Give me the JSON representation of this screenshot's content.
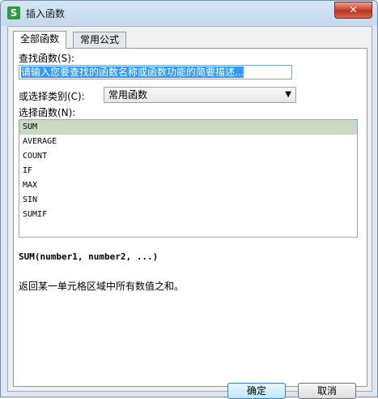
{
  "window": {
    "title": "插入函数",
    "app_icon": "S",
    "close_glyph": "✕"
  },
  "tabs": [
    {
      "label": "全部函数"
    },
    {
      "label": "常用公式"
    }
  ],
  "search": {
    "label": "查找函数(S):",
    "value": "请输入您要查找的函数名称或函数功能的简要描述..."
  },
  "category": {
    "label": "或选择类别(C):",
    "selected": "常用函数",
    "arrow": "▼"
  },
  "functions": {
    "label": "选择函数(N):",
    "items": [
      "SUM",
      "AVERAGE",
      "COUNT",
      "IF",
      "MAX",
      "SIN",
      "SUMIF"
    ]
  },
  "detail": {
    "signature": "SUM(number1, number2, ...)",
    "description": "返回某一单元格区域中所有数值之和。"
  },
  "buttons": {
    "ok": "确定",
    "cancel": "取消"
  },
  "colors": {
    "selection": "#c9dcc2",
    "highlight": "#3399ff",
    "close": "#c7432b"
  }
}
